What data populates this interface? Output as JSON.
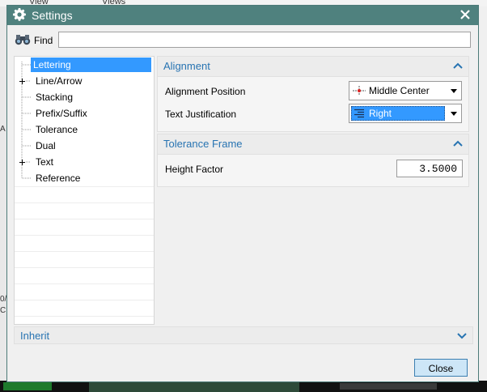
{
  "background": {
    "menu_view": "View",
    "menu_views": "Views",
    "side_fragments": [
      "A",
      "0/",
      "C"
    ]
  },
  "dialog": {
    "title": "Settings",
    "find_label": "Find",
    "find_value": "",
    "tree": {
      "items": [
        {
          "label": "Lettering",
          "expandable": false,
          "selected": true
        },
        {
          "label": "Line/Arrow",
          "expandable": true,
          "selected": false
        },
        {
          "label": "Stacking",
          "expandable": false,
          "selected": false
        },
        {
          "label": "Prefix/Suffix",
          "expandable": false,
          "selected": false
        },
        {
          "label": "Tolerance",
          "expandable": false,
          "selected": false
        },
        {
          "label": "Dual",
          "expandable": false,
          "selected": false
        },
        {
          "label": "Text",
          "expandable": true,
          "selected": false
        },
        {
          "label": "Reference",
          "expandable": false,
          "selected": false
        }
      ]
    },
    "alignment": {
      "title": "Alignment",
      "position_label": "Alignment Position",
      "position_value": "Middle Center",
      "justification_label": "Text Justification",
      "justification_value": "Right"
    },
    "tolerance_frame": {
      "title": "Tolerance Frame",
      "height_factor_label": "Height Factor",
      "height_factor_value": "3.5000"
    },
    "inherit": {
      "title": "Inherit"
    },
    "close_label": "Close"
  },
  "colors": {
    "titlebar": "#4f817e",
    "selection": "#3399ff",
    "section_title": "#2874b2",
    "close_button": "#cde6f7"
  }
}
